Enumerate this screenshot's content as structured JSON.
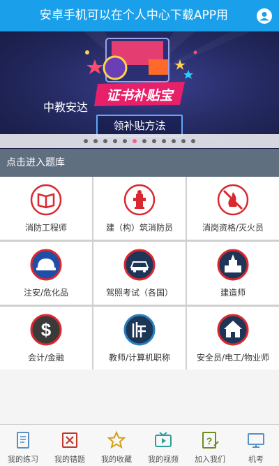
{
  "header": {
    "title": "安卓手机可以在个人中心下载APP用",
    "user_icon": "user-icon"
  },
  "banner": {
    "headline": "中教安达",
    "graphic_text": "证书补贴宝",
    "button_label": "领补贴方法",
    "carousel_total": 12,
    "carousel_active": 5
  },
  "section": {
    "title": "点击进入题库"
  },
  "categories": [
    {
      "label": "消防工程师",
      "icon": "book-icon"
    },
    {
      "label": "建（构）筑消防员",
      "icon": "fire-hydrant-icon"
    },
    {
      "label": "消岗资格/灭火员",
      "icon": "no-fire-icon"
    },
    {
      "label": "注安/危化品",
      "icon": "helmet-icon"
    },
    {
      "label": "驾照考试（各国）",
      "icon": "car-icon"
    },
    {
      "label": "建造师",
      "icon": "building-icon"
    },
    {
      "label": "会计/金融",
      "icon": "dollar-icon"
    },
    {
      "label": "教师/计算机职称",
      "icon": "teacher-icon"
    },
    {
      "label": "安全员/电工/物业师",
      "icon": "house-icon"
    }
  ],
  "tabs": [
    {
      "label": "我的练习",
      "icon": "notebook-icon"
    },
    {
      "label": "我的错题",
      "icon": "wrong-icon"
    },
    {
      "label": "我的收藏",
      "icon": "star-icon"
    },
    {
      "label": "我的视频",
      "icon": "tv-icon"
    },
    {
      "label": "加入我们",
      "icon": "question-icon"
    },
    {
      "label": "机考",
      "icon": "monitor-icon"
    }
  ],
  "colors": {
    "accent": "#1aa0ea",
    "section_bg": "#5f6f80",
    "icon_red": "#d9282f",
    "icon_navy": "#1d3557"
  }
}
